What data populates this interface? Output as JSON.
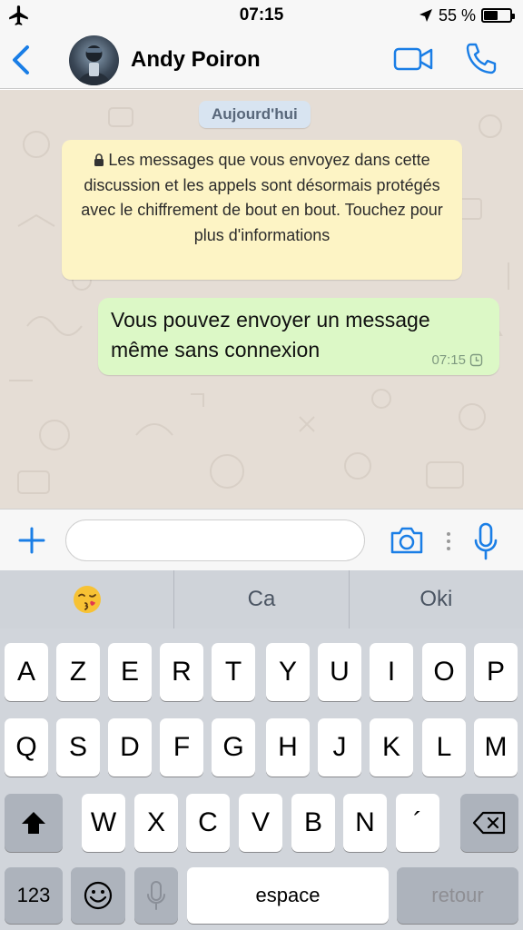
{
  "status_bar": {
    "time": "07:15",
    "battery_percent": "55 %",
    "battery_level": 0.55,
    "icons": [
      "airplane-icon",
      "location-arrow-icon",
      "battery-icon"
    ]
  },
  "header": {
    "contact_name": "Andy Poiron",
    "icons": [
      "chevron-left-icon",
      "avatar",
      "video-camera-icon",
      "phone-icon"
    ],
    "accent_color": "#1a7ee6"
  },
  "chat": {
    "date_pill": "Aujourd'hui",
    "encryption_notice": "Les messages que vous envoyez dans cette discussion et les appels sont désormais protégés avec le chiffrement de bout en bout. Touchez pour plus d'informations",
    "messages": [
      {
        "direction": "outgoing",
        "text": "Vous pouvez envoyer un message même sans connexion",
        "time": "07:15",
        "status_icon": "clock-icon"
      }
    ],
    "background_color": "#e5ddd5",
    "outgoing_bubble_color": "#dcf8c6",
    "notice_color": "#fdf4c5"
  },
  "input_bar": {
    "placeholder": "",
    "value": "",
    "icons": [
      "plus-icon",
      "camera-icon",
      "dots-icon",
      "microphone-icon"
    ]
  },
  "keyboard": {
    "suggestions": [
      "😘",
      "Ca",
      "Oki"
    ],
    "row1": [
      "A",
      "Z",
      "E",
      "R",
      "T",
      "Y",
      "U",
      "I",
      "O",
      "P"
    ],
    "row2": [
      "Q",
      "S",
      "D",
      "F",
      "G",
      "H",
      "J",
      "K",
      "L",
      "M"
    ],
    "row3": [
      "W",
      "X",
      "C",
      "V",
      "B",
      "N",
      "´"
    ],
    "numbers_key": "123",
    "space_key": "espace",
    "return_key": "retour",
    "icons": [
      "shift-icon",
      "backspace-icon",
      "emoji-icon",
      "dictation-mic-icon"
    ]
  }
}
